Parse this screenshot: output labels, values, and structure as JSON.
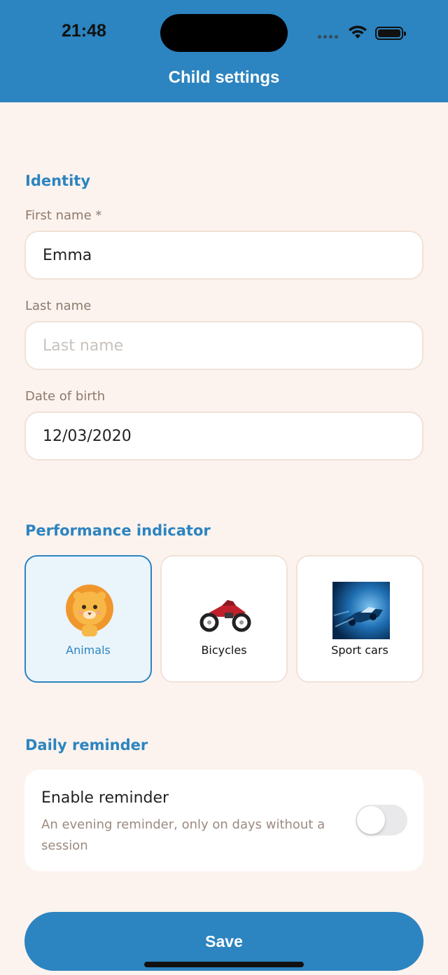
{
  "status_bar": {
    "time": "21:48"
  },
  "header": {
    "title": "Child settings"
  },
  "identity": {
    "section_title": "Identity",
    "first_name": {
      "label": "First name *",
      "value": "Emma"
    },
    "last_name": {
      "label": "Last name",
      "value": "",
      "placeholder": "Last name"
    },
    "dob": {
      "label": "Date of birth",
      "value": "12/03/2020"
    }
  },
  "performance": {
    "section_title": "Performance indicator",
    "options": [
      {
        "label": "Animals",
        "icon": "lion-icon",
        "selected": true
      },
      {
        "label": "Bicycles",
        "icon": "motorcycle-icon",
        "selected": false
      },
      {
        "label": "Sport cars",
        "icon": "sport-car-icon",
        "selected": false
      }
    ]
  },
  "reminder": {
    "section_title": "Daily reminder",
    "title": "Enable reminder",
    "description": "An evening reminder, only on days without a session",
    "enabled": false
  },
  "save_label": "Save",
  "colors": {
    "accent": "#2c84c0",
    "background": "#fcf3ee",
    "border": "#f1e2d8"
  }
}
